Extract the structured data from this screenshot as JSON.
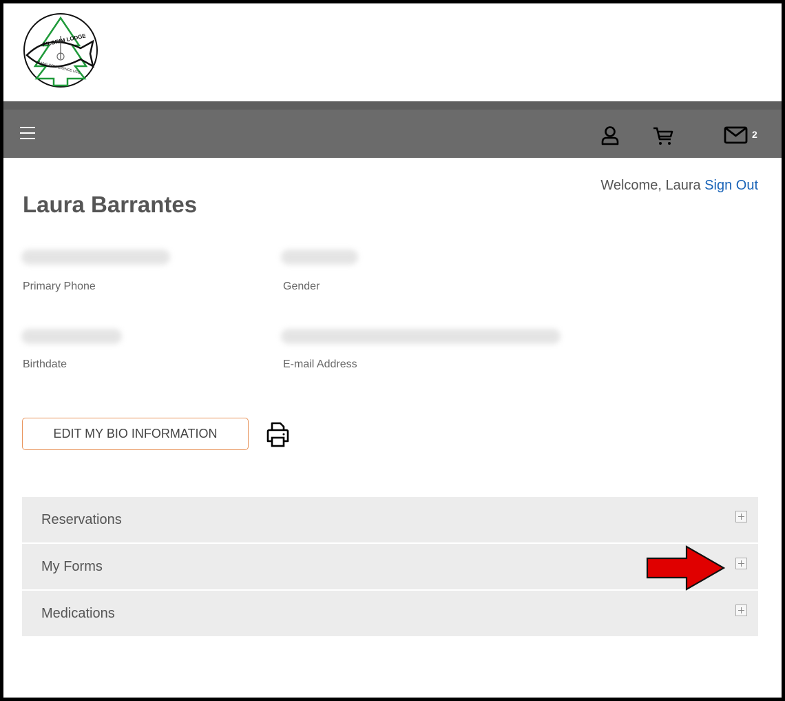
{
  "logo": {
    "name": "pilgrim-lodge-logo",
    "top_text": "PILGRIM LODGE",
    "bottom_text": "MAINE CONFERENCE UCC"
  },
  "navbar": {
    "icons": [
      "hamburger-menu-icon",
      "user-icon",
      "cart-icon",
      "mail-icon"
    ],
    "mail_count": "2"
  },
  "welcome": {
    "text": "Welcome, Laura",
    "sign_out": "Sign Out"
  },
  "profile": {
    "name": "Laura Barrantes",
    "fields": [
      {
        "label": "Primary Phone"
      },
      {
        "label": "Gender"
      },
      {
        "label": "Birthdate"
      },
      {
        "label": "E-mail Address"
      }
    ]
  },
  "actions": {
    "edit_bio": "EDIT MY BIO INFORMATION",
    "print_icon": "printer-icon"
  },
  "accordions": [
    {
      "label": "Reservations"
    },
    {
      "label": "My Forms"
    },
    {
      "label": "Medications"
    }
  ],
  "colors": {
    "navbar": "#6b6b6b",
    "link": "#1a64b8",
    "button_border": "#e8935a",
    "accordion_bg": "#ececec",
    "arrow": "#e00000",
    "logo_tree": "#1f9a3a"
  }
}
